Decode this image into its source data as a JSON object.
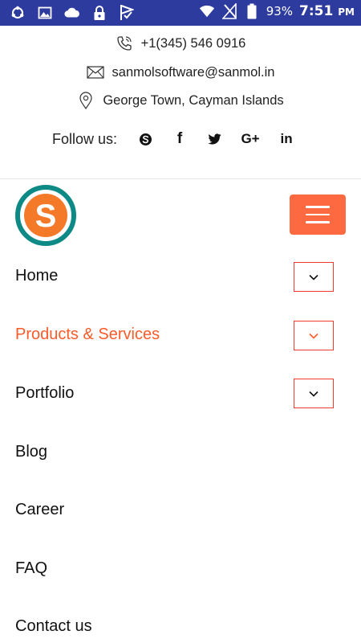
{
  "status_bar": {
    "battery_percent": "93%",
    "time": "7:51",
    "ampm": "PM"
  },
  "contact": {
    "phone": "+1(345) 546 0916",
    "email": "sanmolsoftware@sanmol.in",
    "address": "George Town, Cayman Islands"
  },
  "social": {
    "follow_label": "Follow us:",
    "gplus_text": "G+",
    "linkedin_text": "in",
    "facebook_text": "f"
  },
  "brand": {
    "logo_letter": "S",
    "accent_color": "#fd6a41",
    "logo_ring_color": "#0e8a86"
  },
  "nav": {
    "items": [
      {
        "label": "Home",
        "has_submenu": true,
        "active": false
      },
      {
        "label": "Products & Services",
        "has_submenu": true,
        "active": true
      },
      {
        "label": "Portfolio",
        "has_submenu": true,
        "active": false
      },
      {
        "label": "Blog",
        "has_submenu": false,
        "active": false
      },
      {
        "label": "Career",
        "has_submenu": false,
        "active": false
      },
      {
        "label": "FAQ",
        "has_submenu": false,
        "active": false
      },
      {
        "label": "Contact us",
        "has_submenu": false,
        "active": false
      }
    ]
  }
}
